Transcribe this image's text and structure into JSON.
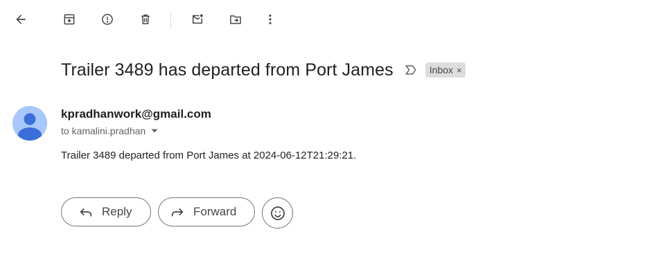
{
  "toolbar": {
    "icons": [
      "back-arrow-icon",
      "archive-icon",
      "report-spam-icon",
      "delete-icon",
      "mark-unread-icon",
      "move-to-icon",
      "more-options-icon"
    ]
  },
  "message": {
    "subject": "Trailer 3489 has departed from Port James",
    "label": "Inbox",
    "label_close": "×",
    "sender": "kpradhanwork@gmail.com",
    "recipient": "to kamalini.pradhan",
    "body": "Trailer 3489 departed from Port James at 2024-06-12T21:29:21."
  },
  "actions": {
    "reply_label": "Reply",
    "forward_label": "Forward"
  },
  "colors": {
    "avatar_bg": "#a8c7fa",
    "avatar_fg": "#3b6ed8",
    "icon": "#444746",
    "chip_bg": "#dddddd"
  }
}
